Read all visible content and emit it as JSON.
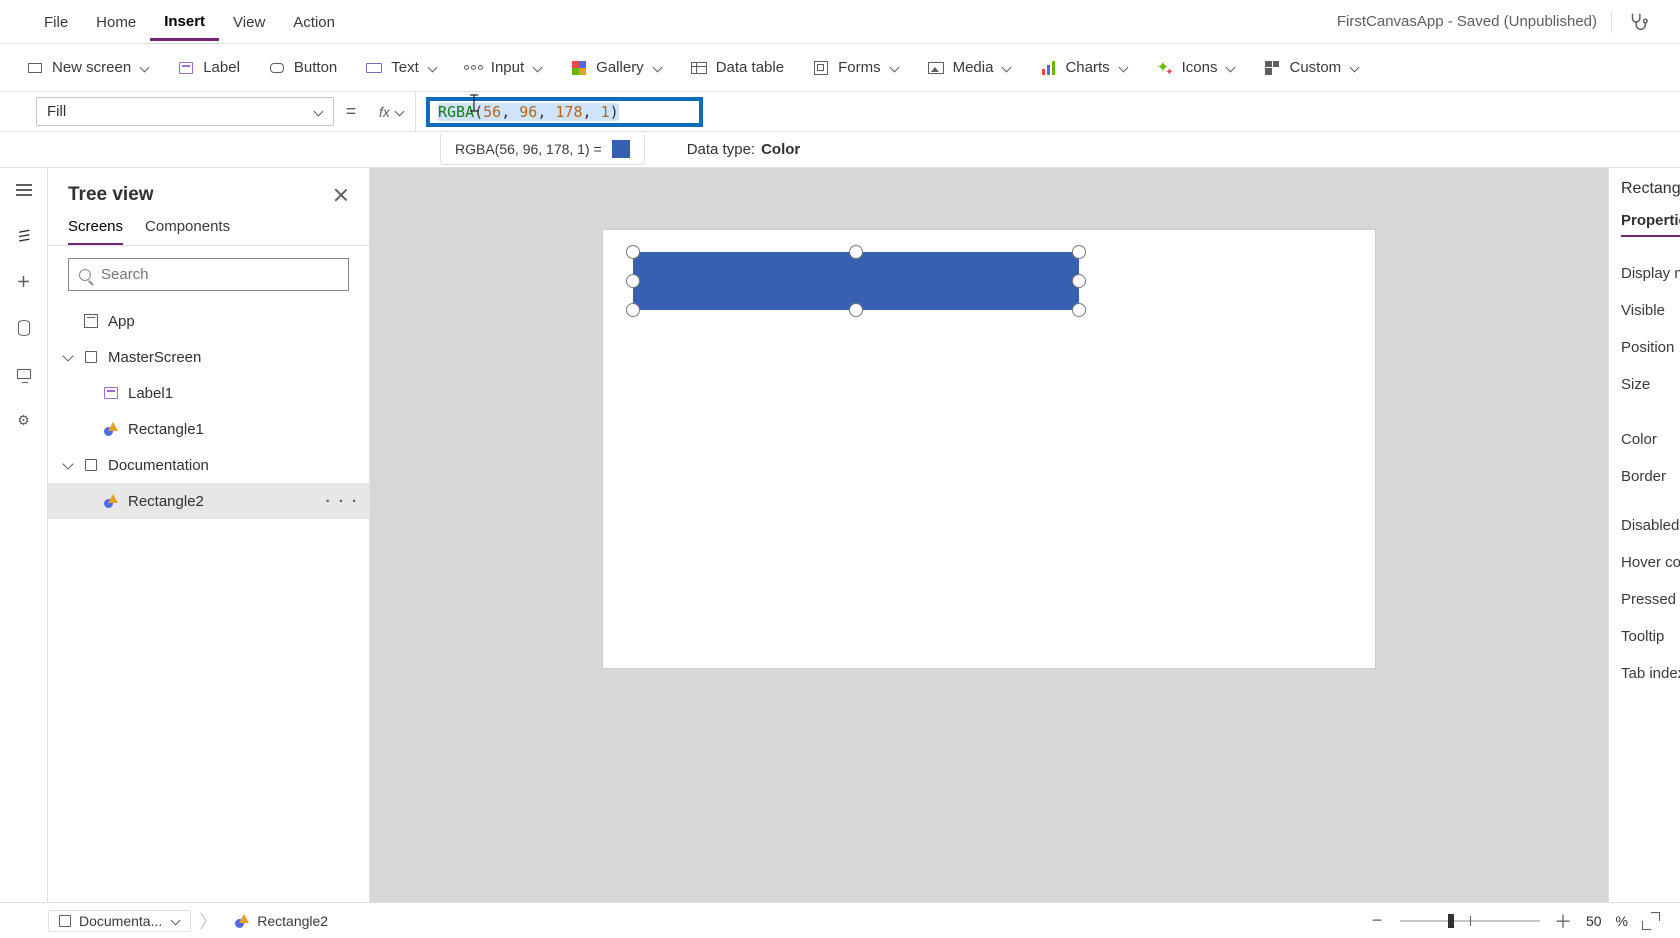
{
  "app_title": "FirstCanvasApp - Saved (Unpublished)",
  "menu": {
    "file": "File",
    "home": "Home",
    "insert": "Insert",
    "view": "View",
    "action": "Action"
  },
  "ribbon": {
    "new_screen": "New screen",
    "label": "Label",
    "button": "Button",
    "text": "Text",
    "input": "Input",
    "gallery": "Gallery",
    "data_table": "Data table",
    "forms": "Forms",
    "media": "Media",
    "charts": "Charts",
    "icons": "Icons",
    "custom": "Custom"
  },
  "formula": {
    "property": "Fill",
    "fx": "fx",
    "expr_fn": "RGBA",
    "expr_n1": "56",
    "expr_n2": "96",
    "expr_n3": "178",
    "expr_n4": "1",
    "result_text": "RGBA(56, 96, 178, 1)  =",
    "datatype_label": "Data type: ",
    "datatype_value": "Color"
  },
  "tree": {
    "title": "Tree view",
    "tabs": {
      "screens": "Screens",
      "components": "Components"
    },
    "search_placeholder": "Search",
    "app": "App",
    "master": "MasterScreen",
    "label1": "Label1",
    "rect1": "Rectangle1",
    "doc": "Documentation",
    "rect2": "Rectangle2",
    "more": "· · ·"
  },
  "rightpanel": {
    "title": "Rectangle",
    "tab": "Properties",
    "rows": {
      "display_mode": "Display mode",
      "visible": "Visible",
      "position": "Position",
      "size": "Size",
      "color": "Color",
      "border": "Border",
      "disabled": "Disabled color",
      "hover": "Hover color",
      "pressed": "Pressed color",
      "tooltip": "Tooltip",
      "tabindex": "Tab index"
    }
  },
  "statusbar": {
    "screen": "Documenta...",
    "control": "Rectangle2",
    "zoom_value": "50",
    "zoom_pct": "%"
  }
}
